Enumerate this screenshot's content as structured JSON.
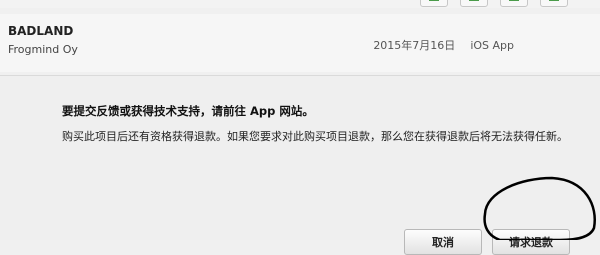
{
  "toolbar": {
    "buttons": [
      {
        "icon": "download-icon"
      },
      {
        "icon": "share-icon"
      },
      {
        "icon": "bookmark-icon"
      },
      {
        "icon": "receipt-icon"
      }
    ]
  },
  "app": {
    "name": "BADLAND",
    "developer": "Frogmind Oy",
    "date": "2015年7月16日",
    "platform": "iOS App"
  },
  "dialog": {
    "title": "要提交反馈或获得技术支持，请前往 App 网站。",
    "body": "购买此项目后还有资格获得退款。如果您要求对此购买项目退款，那么您在获得退款后将无法获得任新。",
    "cancel_label": "取消",
    "refund_label": "请求退款"
  },
  "colors": {
    "background": "#efefef",
    "button_border": "#b8b8b8",
    "annotation_stroke": "#000000"
  }
}
